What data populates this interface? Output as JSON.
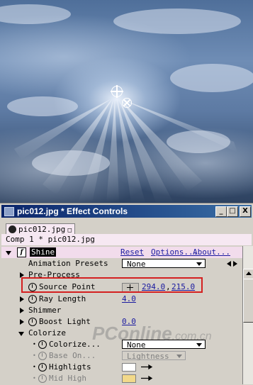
{
  "window": {
    "title": "pic012.jpg * Effect Controls",
    "minimize": "_",
    "maximize": "□",
    "close": "X"
  },
  "tab": {
    "label": "pic012.jpg",
    "close": "□"
  },
  "comp_path": "Comp 1 * pic012.jpg",
  "effect": {
    "name": "Shine",
    "reset_label": "Reset",
    "options_label": "Options...",
    "about_label": "About..."
  },
  "rows": {
    "animation_presets": {
      "label": "Animation Presets",
      "value": "None"
    },
    "pre_process": {
      "label": "Pre-Process"
    },
    "source_point": {
      "label": "Source Point",
      "x": "294.0",
      "sep": ",",
      "y": "215.0"
    },
    "ray_length": {
      "label": "Ray Length",
      "value": "4.0"
    },
    "shimmer": {
      "label": "Shimmer"
    },
    "boost_light": {
      "label": "Boost Light",
      "value": "0.0"
    },
    "colorize": {
      "label": "Colorize"
    },
    "colorize_sub": {
      "label": "Colorize...",
      "value": "None"
    },
    "base_on": {
      "label": "Base On...",
      "value": "Lightness"
    },
    "highlights": {
      "label": "Highligts",
      "color": "#ffffff"
    },
    "mid_high": {
      "label": "Mid High",
      "color": "#f2d98a"
    }
  },
  "watermark": {
    "main": "PConline",
    "suffix": ".com.cn"
  },
  "colors": {
    "highlight_box": "#d42020",
    "link": "#1a1aa0",
    "title_bar": "#0a246a"
  },
  "icons": {
    "source_crosshair": "crosshair-icon",
    "light_point": "circle-x-icon",
    "stopwatch": "stopwatch-icon",
    "effect": "fx-icon",
    "position": "position-icon",
    "eyedropper": "eyedropper-icon"
  }
}
